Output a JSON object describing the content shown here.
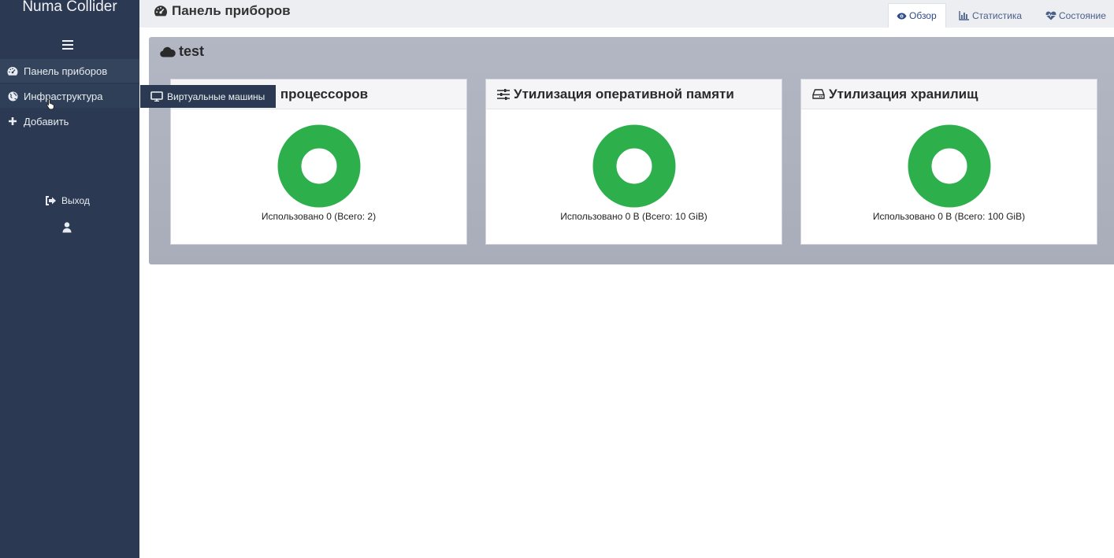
{
  "app": {
    "brand": "Numa Collider"
  },
  "sidebar": {
    "items": [
      {
        "label": "Панель приборов",
        "icon": "dashboard-icon"
      },
      {
        "label": "Инфраструктура",
        "icon": "globe-icon"
      },
      {
        "label": "Добавить",
        "icon": "plus-icon"
      }
    ],
    "logout_label": "Выход",
    "submenu": {
      "label": "Виртуальные машины",
      "icon": "monitor-icon"
    }
  },
  "header": {
    "title": "Панель приборов",
    "tabs": [
      {
        "label": "Обзор",
        "icon": "eye-icon",
        "active": true
      },
      {
        "label": "Статистика",
        "icon": "bar-chart-icon"
      },
      {
        "label": "Состояние",
        "icon": "heartbeat-icon"
      }
    ]
  },
  "panel": {
    "title": "test",
    "cards": [
      {
        "title": "Утилизация процессоров",
        "caption": "Использовано 0 (Всего: 2)",
        "icon": "cpu-icon",
        "used_fraction": 0
      },
      {
        "title": "Утилизация оперативной памяти",
        "caption": "Использовано 0 B (Всего: 10 GiB)",
        "icon": "sliders-icon",
        "used_fraction": 0
      },
      {
        "title": "Утилизация хранилищ",
        "caption": "Использовано 0 B (Всего: 100 GiB)",
        "icon": "hdd-icon",
        "used_fraction": 0
      }
    ]
  },
  "colors": {
    "sidebar_bg": "#2b3a52",
    "donut_free": "#2db04b",
    "tab_active": "#2e4a8a"
  }
}
